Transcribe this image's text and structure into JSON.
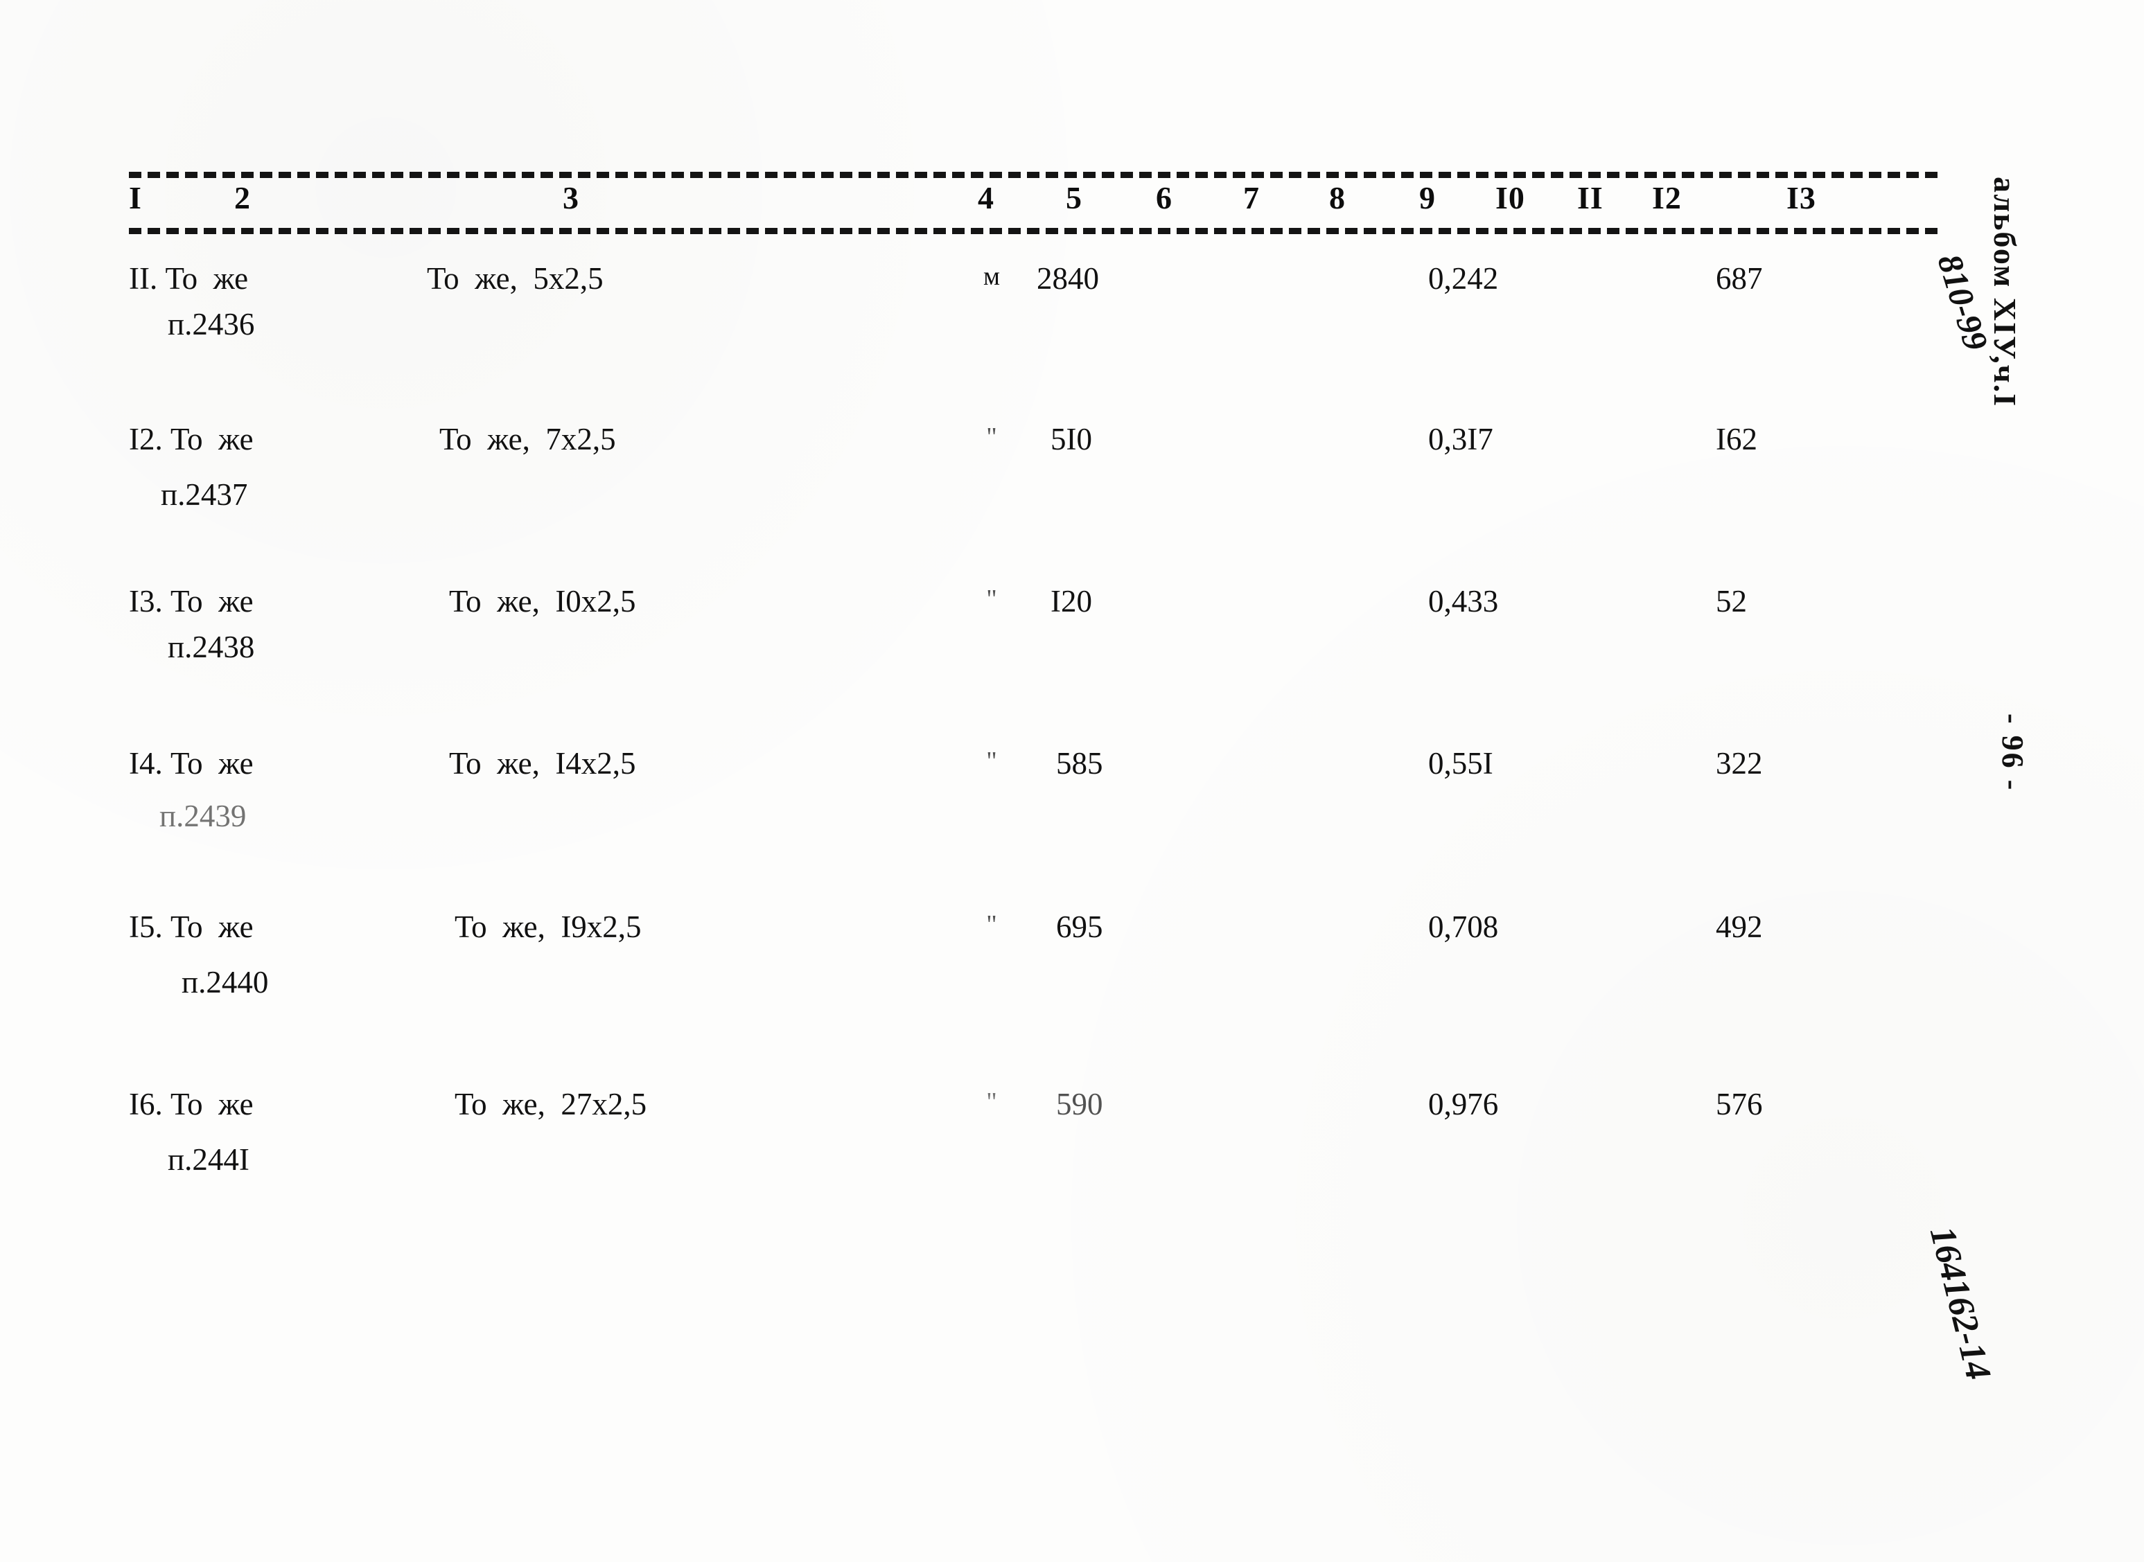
{
  "document": {
    "album_label": "альбом XIУ,ч.I",
    "album_code": "810-99",
    "page_number": "- 96 -",
    "archive_code": "164162-14"
  },
  "table": {
    "column_headers": [
      "I",
      "2",
      "3",
      "4",
      "5",
      "6",
      "7",
      "8",
      "9",
      "I0",
      "II",
      "I2",
      "I3"
    ],
    "rows": [
      {
        "num": "II.",
        "name": "То  же",
        "name_sub": "п.2436",
        "desc": "То  же,  5х2,5",
        "unit": "м",
        "qty": "2840",
        "weight": "0,242",
        "total": "687"
      },
      {
        "num": "I2.",
        "name": "То  же",
        "name_sub": "п.2437",
        "desc": "То  же,  7х2,5",
        "unit": "\"",
        "qty": "5I0",
        "weight": "0,3I7",
        "total": "I62"
      },
      {
        "num": "I3.",
        "name": "То  же",
        "name_sub": "п.2438",
        "desc": "То  же,  I0х2,5",
        "unit": "\"",
        "qty": "I20",
        "weight": "0,433",
        "total": "52"
      },
      {
        "num": "I4.",
        "name": "То  же",
        "name_sub": "п.2439",
        "desc": "То  же,  I4х2,5",
        "unit": "\"",
        "qty": "585",
        "weight": "0,55I",
        "total": "322"
      },
      {
        "num": "I5.",
        "name": "То  же",
        "name_sub": "п.2440",
        "desc": "То  же,  I9х2,5",
        "unit": "\"",
        "qty": "695",
        "weight": "0,708",
        "total": "492"
      },
      {
        "num": "I6.",
        "name": "То  же",
        "name_sub": "п.244I",
        "desc": "То  же,  27х2,5",
        "unit": "\"",
        "qty": "590",
        "weight": "0,976",
        "total": "576"
      }
    ]
  }
}
